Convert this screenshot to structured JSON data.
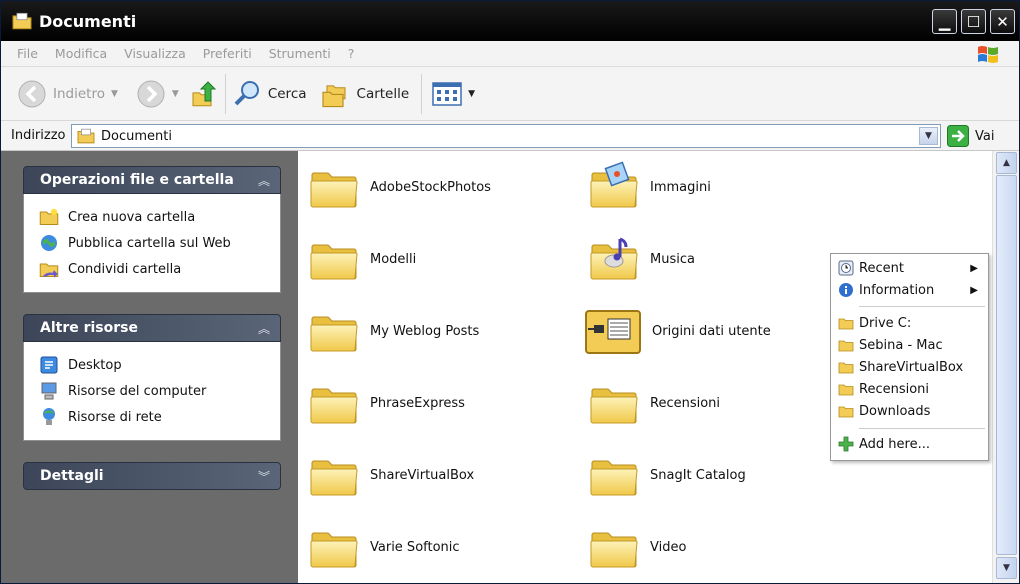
{
  "window": {
    "title": "Documenti"
  },
  "menu": [
    "File",
    "Modifica",
    "Visualizza",
    "Preferiti",
    "Strumenti",
    "?"
  ],
  "toolbar": {
    "back": "Indietro",
    "search": "Cerca",
    "folders": "Cartelle"
  },
  "address": {
    "label": "Indirizzo",
    "path": "Documenti",
    "go": "Vai"
  },
  "panels": {
    "tasks": {
      "title": "Operazioni file e cartella",
      "items": [
        "Crea nuova cartella",
        "Pubblica cartella sul Web",
        "Condividi cartella"
      ]
    },
    "other": {
      "title": "Altre risorse",
      "items": [
        "Desktop",
        "Risorse del computer",
        "Risorse di rete"
      ]
    },
    "details": {
      "title": "Dettagli"
    }
  },
  "folders": [
    "AdobeStockPhotos",
    "Immagini",
    "Modelli",
    "Musica",
    "My Weblog Posts",
    "Origini dati utente",
    "PhraseExpress",
    "Recensioni",
    "ShareVirtualBox",
    "SnagIt Catalog",
    "Varie Softonic",
    "Video"
  ],
  "context_menu": {
    "submenus": [
      "Recent",
      "Information"
    ],
    "places": [
      "Drive C:",
      "Sebina - Mac",
      "ShareVirtualBox",
      "Recensioni",
      "Downloads"
    ],
    "add": "Add here..."
  },
  "colors": {
    "title_bar": "#000000",
    "side_panel": "#6b6b6b",
    "panel_header": "#4a5468",
    "folder": "#f5d76e"
  }
}
